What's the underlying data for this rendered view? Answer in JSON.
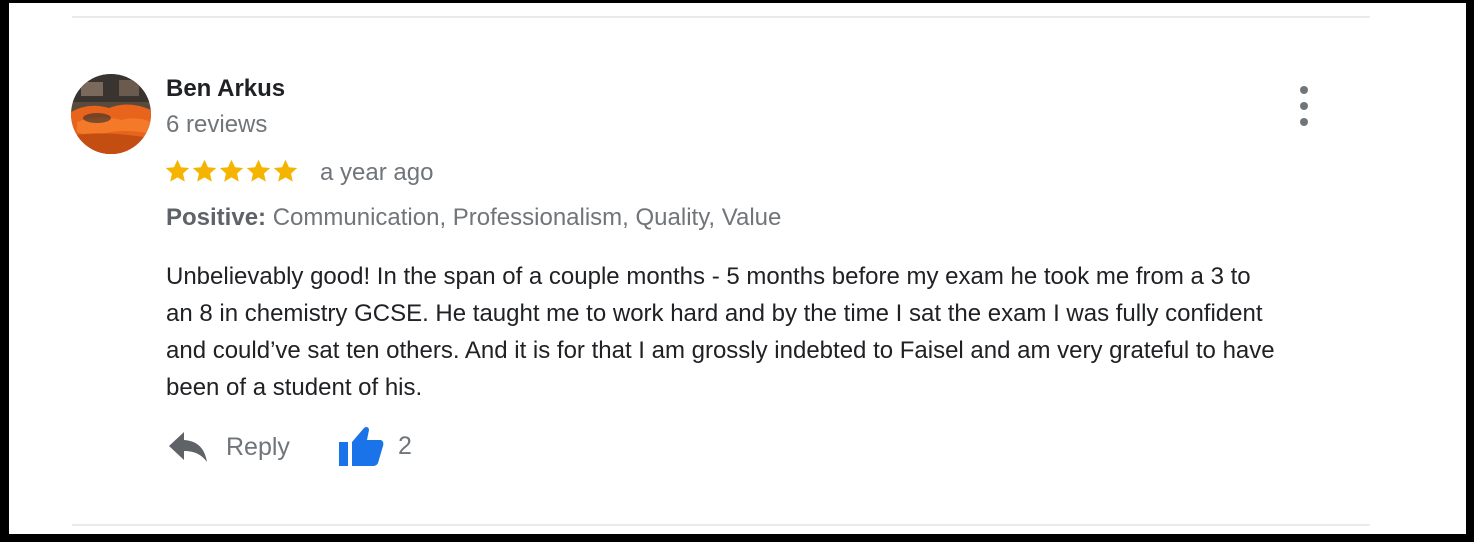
{
  "review": {
    "reviewer": {
      "name": "Ben Arkus",
      "review_count": "6 reviews",
      "avatar_icon": "profile-photo-orange-car"
    },
    "rating": 5,
    "rating_max": 5,
    "date": "a year ago",
    "highlights": {
      "label": "Positive:",
      "values": "Communication, Professionalism, Quality, Value"
    },
    "text": "Unbelievably good! In the span of a couple months - 5 months before my exam he took me from a 3 to\nan 8 in chemistry GCSE. He taught me to work hard and by the time I sat the exam I was fully confident\nand could’ve sat ten others. And it is for that I am grossly indebted to Faisel and am very grateful to have\nbeen of a student of his.",
    "actions": {
      "reply_label": "Reply",
      "reply_icon": "reply-arrow-icon",
      "like_count": "2",
      "like_icon": "thumbs-up-icon",
      "more_icon": "more-vertical-icon"
    }
  },
  "colors": {
    "star": "#f4b400",
    "like": "#1a73e8",
    "secondary_text": "#70757a",
    "primary_text": "#202124",
    "divider": "#e8eaed"
  }
}
